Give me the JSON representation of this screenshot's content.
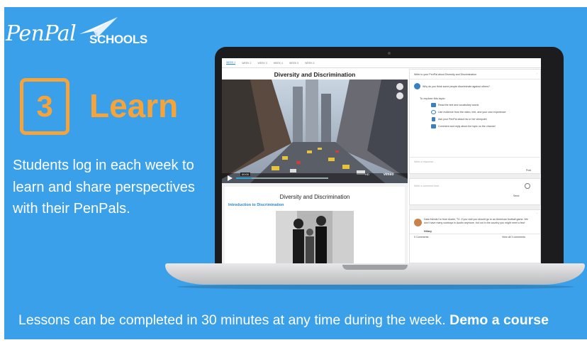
{
  "brand": {
    "script": "PenPal",
    "schools": "SCHOOLS"
  },
  "step": {
    "number": "3",
    "title": "Learn"
  },
  "lead_text": "Students log in each week to learn and share perspectives with their PenPals.",
  "caption": {
    "text": "Lessons can be completed in 30 minutes at any time during the week.",
    "link": "Demo a course"
  },
  "screen": {
    "tabs": [
      "WEEK 1",
      "WEEK 2",
      "WEEK 3",
      "WEEK 4",
      "WEEK 5",
      "WEEK 6"
    ],
    "lesson_title": "Diversity and Discrimination",
    "reading_title": "Diversity and Discrimination",
    "reading_subtitle": "Introduction to Discrimination",
    "prompt_header": "Write to your PenPal about Diversity and Discrimination",
    "prompt_question": "Why do you think some people discriminate against others?",
    "explore_label": "To explore this topic:",
    "steps": [
      "Read the text and vocabulary words",
      "Use evidence from the video, text, and your own experience",
      "Ask your PenPal about his or her viewpoint",
      "Comment and reply about the topic on the channel"
    ],
    "reply_placeholder": "Write a response…",
    "post_label": "Post",
    "comment_placeholder": "Write a comment here…",
    "comment_send": "Send",
    "post_body": "Data friends I'm from Austin, TX. If you visit you should go to an American football game. We don't have many cowboys in Austin anymore, but out in the country you might meet a few!",
    "post_author": "Hillary",
    "post_comments": "0 Comments",
    "post_view": "View all 3 comments",
    "video_brand": "vimeo",
    "video_badge": "HD"
  },
  "colors": {
    "background": "#3aa0ea",
    "accent_orange": "#f6a43a",
    "link_blue": "#2e85c8"
  }
}
